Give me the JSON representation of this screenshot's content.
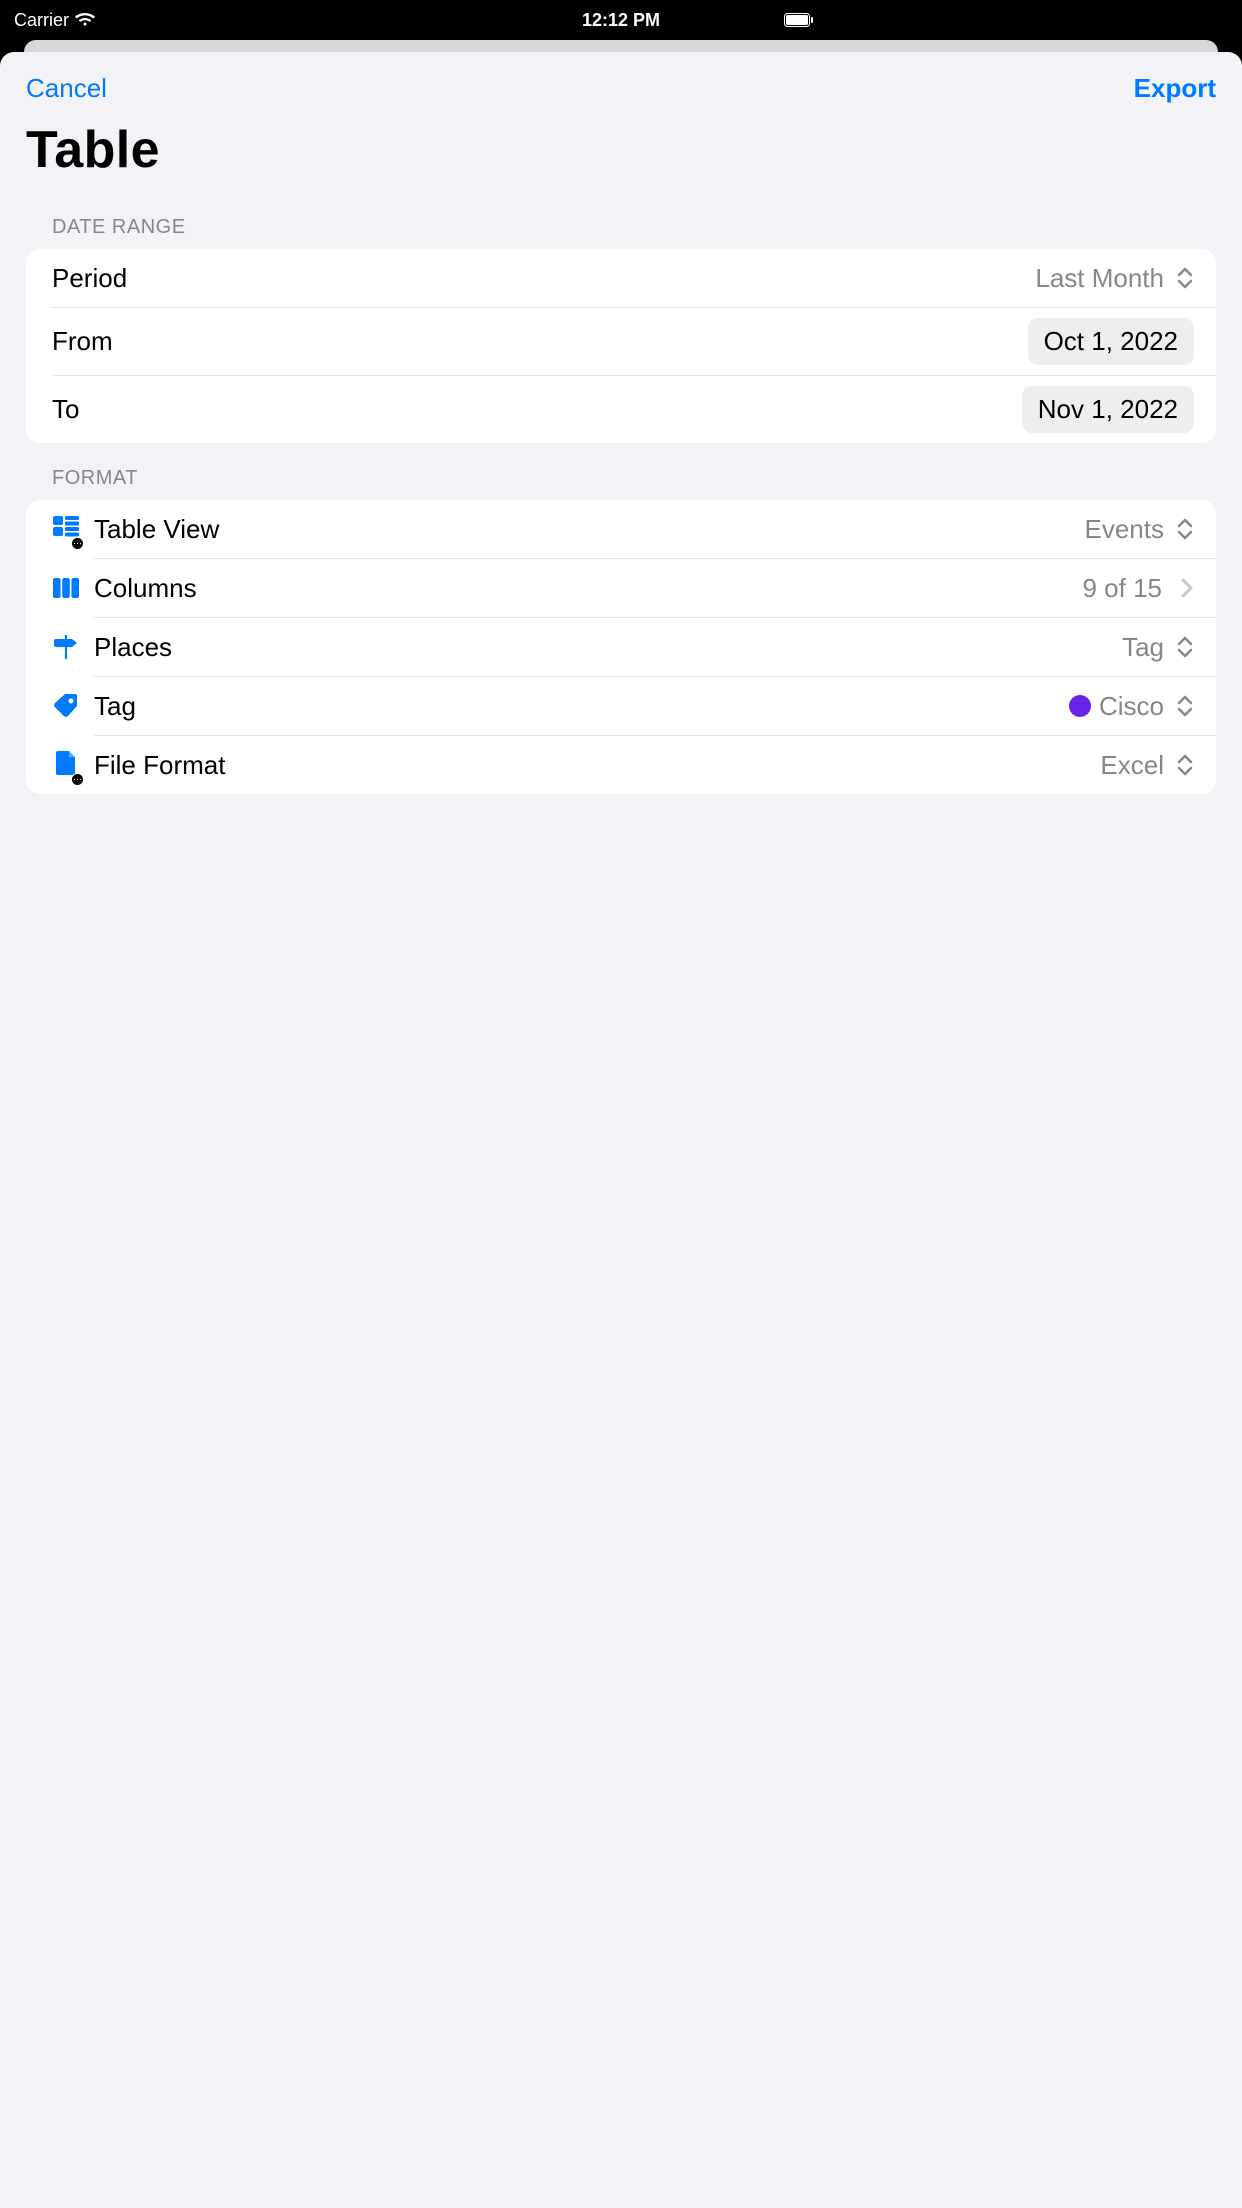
{
  "status": {
    "carrier": "Carrier",
    "time": "12:12 PM"
  },
  "nav": {
    "cancel": "Cancel",
    "export": "Export"
  },
  "title": "Table",
  "sections": {
    "date_range": {
      "header": "DATE RANGE",
      "period_label": "Period",
      "period_value": "Last Month",
      "from_label": "From",
      "from_value": "Oct 1, 2022",
      "to_label": "To",
      "to_value": "Nov 1, 2022"
    },
    "format": {
      "header": "FORMAT",
      "table_view_label": "Table View",
      "table_view_value": "Events",
      "columns_label": "Columns",
      "columns_value": "9 of 15",
      "places_label": "Places",
      "places_value": "Tag",
      "tag_label": "Tag",
      "tag_value": "Cisco",
      "file_format_label": "File Format",
      "file_format_value": "Excel"
    }
  },
  "colors": {
    "accent": "#007aff",
    "tag_dot": "#6a21e9"
  }
}
